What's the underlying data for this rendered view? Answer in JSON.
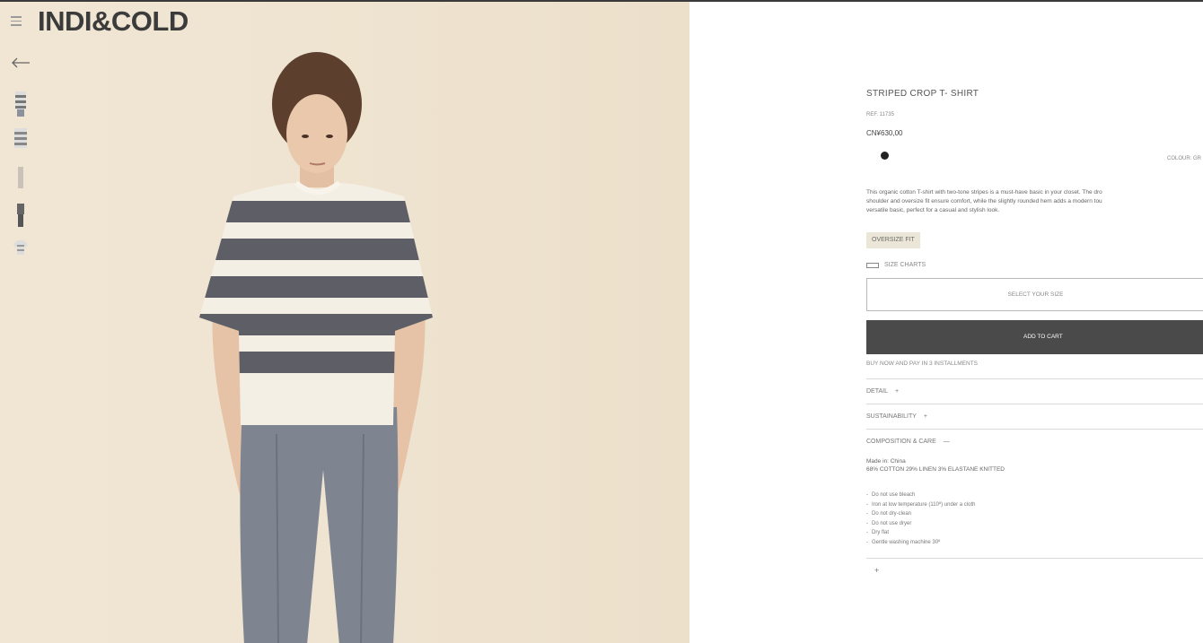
{
  "brand": "INDI&COLD",
  "nav": {
    "menu_icon": "menu-icon",
    "back_icon": "arrow-left-icon"
  },
  "product": {
    "title": "STRIPED CROP T- SHIRT",
    "ref": "REF. 11735",
    "price": "CN¥630,00",
    "colour_label": "COLOUR: GR",
    "description": [
      "This organic cotton T-shirt with two-tone stripes is a must-have basic in your closet. The dro",
      "shoulder and oversize fit ensure comfort, while the slightly rounded hem adds a modern tou",
      "versatile basic, perfect for a casual and stylish look."
    ],
    "fit_badge": "OVERSIZE FIT",
    "size_charts": "SIZE CHARTS",
    "size_placeholder": "SELECT YOUR SIZE",
    "add_to_cart": "ADD TO CART",
    "installments": "BUY NOW AND PAY IN 3 INSTALLMENTS",
    "accordions": [
      {
        "label": "DETAIL",
        "sign": "+"
      },
      {
        "label": "SUSTAINABILITY",
        "sign": "+"
      },
      {
        "label": "COMPOSITION & CARE",
        "sign": "—"
      }
    ],
    "made_in": "Made in: China",
    "composition": "68% COTTON 29% LINEN 3% ELASTANE KNITTED",
    "care": [
      "Do not use bleach",
      "Iron at low temperature (110º) under a cloth",
      "Do not dry-clean",
      "Do not use dryer",
      "Dry flat",
      "Gentle washing machine 30º"
    ],
    "bottom_sign": "+"
  },
  "colors": {
    "button": "#4a4a4a",
    "background_wall": "#efe5d3",
    "stripe": "#5e5f66"
  }
}
